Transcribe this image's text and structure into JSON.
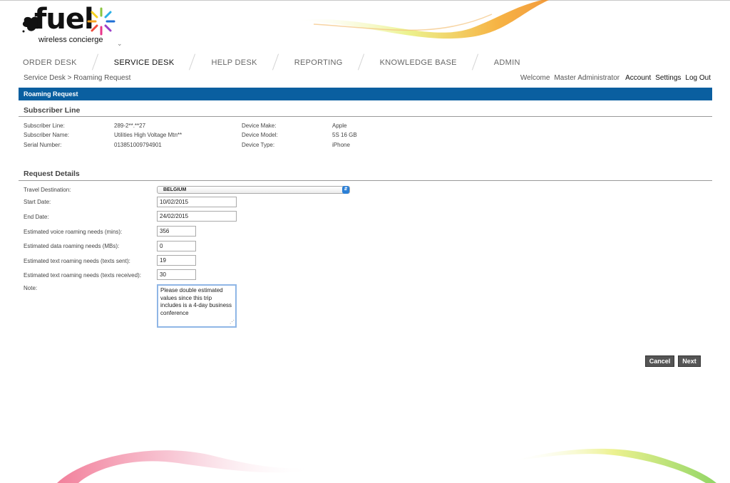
{
  "logo": {
    "word": "fuel",
    "tagline": "wireless concierge"
  },
  "nav": {
    "items": [
      {
        "label": "ORDER DESK",
        "active": false
      },
      {
        "label": "SERVICE DESK",
        "active": true
      },
      {
        "label": "HELP DESK",
        "active": false
      },
      {
        "label": "REPORTING",
        "active": false
      },
      {
        "label": "KNOWLEDGE BASE",
        "active": false
      },
      {
        "label": "ADMIN",
        "active": false
      }
    ]
  },
  "breadcrumb": "Service Desk > Roaming Request",
  "userbar": {
    "welcome": "Welcome",
    "user": "Master Administrator",
    "account": "Account",
    "settings": "Settings",
    "logout": "Log Out"
  },
  "page_title": "Roaming Request",
  "subscriber": {
    "title": "Subscriber Line",
    "line_label": "Subscriber Line:",
    "line_value": "289-2**.**27",
    "name_label": "Subscriber Name:",
    "name_value": "Utilities High Voltage Mtn**",
    "serial_label": "Serial Number:",
    "serial_value": "013851009794901",
    "make_label": "Device Make:",
    "make_value": "Apple",
    "model_label": "Device Model:",
    "model_value": "5S 16 GB",
    "type_label": "Device Type:",
    "type_value": "iPhone"
  },
  "request": {
    "title": "Request Details",
    "destination_label": "Travel Destination:",
    "destination_value": "BELGIUM",
    "start_label": "Start Date:",
    "start_value": "10/02/2015",
    "end_label": "End Date:",
    "end_value": "24/02/2015",
    "voice_label": "Estimated voice roaming needs (mins):",
    "voice_value": "356",
    "data_label": "Estimated data roaming needs (MBs):",
    "data_value": "0",
    "text_sent_label": "Estimated text roaming needs (texts sent):",
    "text_sent_value": "19",
    "text_recv_label": "Estimated text roaming needs (texts received):",
    "text_recv_value": "30",
    "note_label": "Note:",
    "note_value": "Please double estimated values since this trip includes is a 4-day business conference"
  },
  "buttons": {
    "cancel": "Cancel",
    "next": "Next"
  },
  "colors": {
    "title_bar": "#0a5fa0",
    "button": "#555555",
    "select_arrow": "#2b7fd6"
  }
}
